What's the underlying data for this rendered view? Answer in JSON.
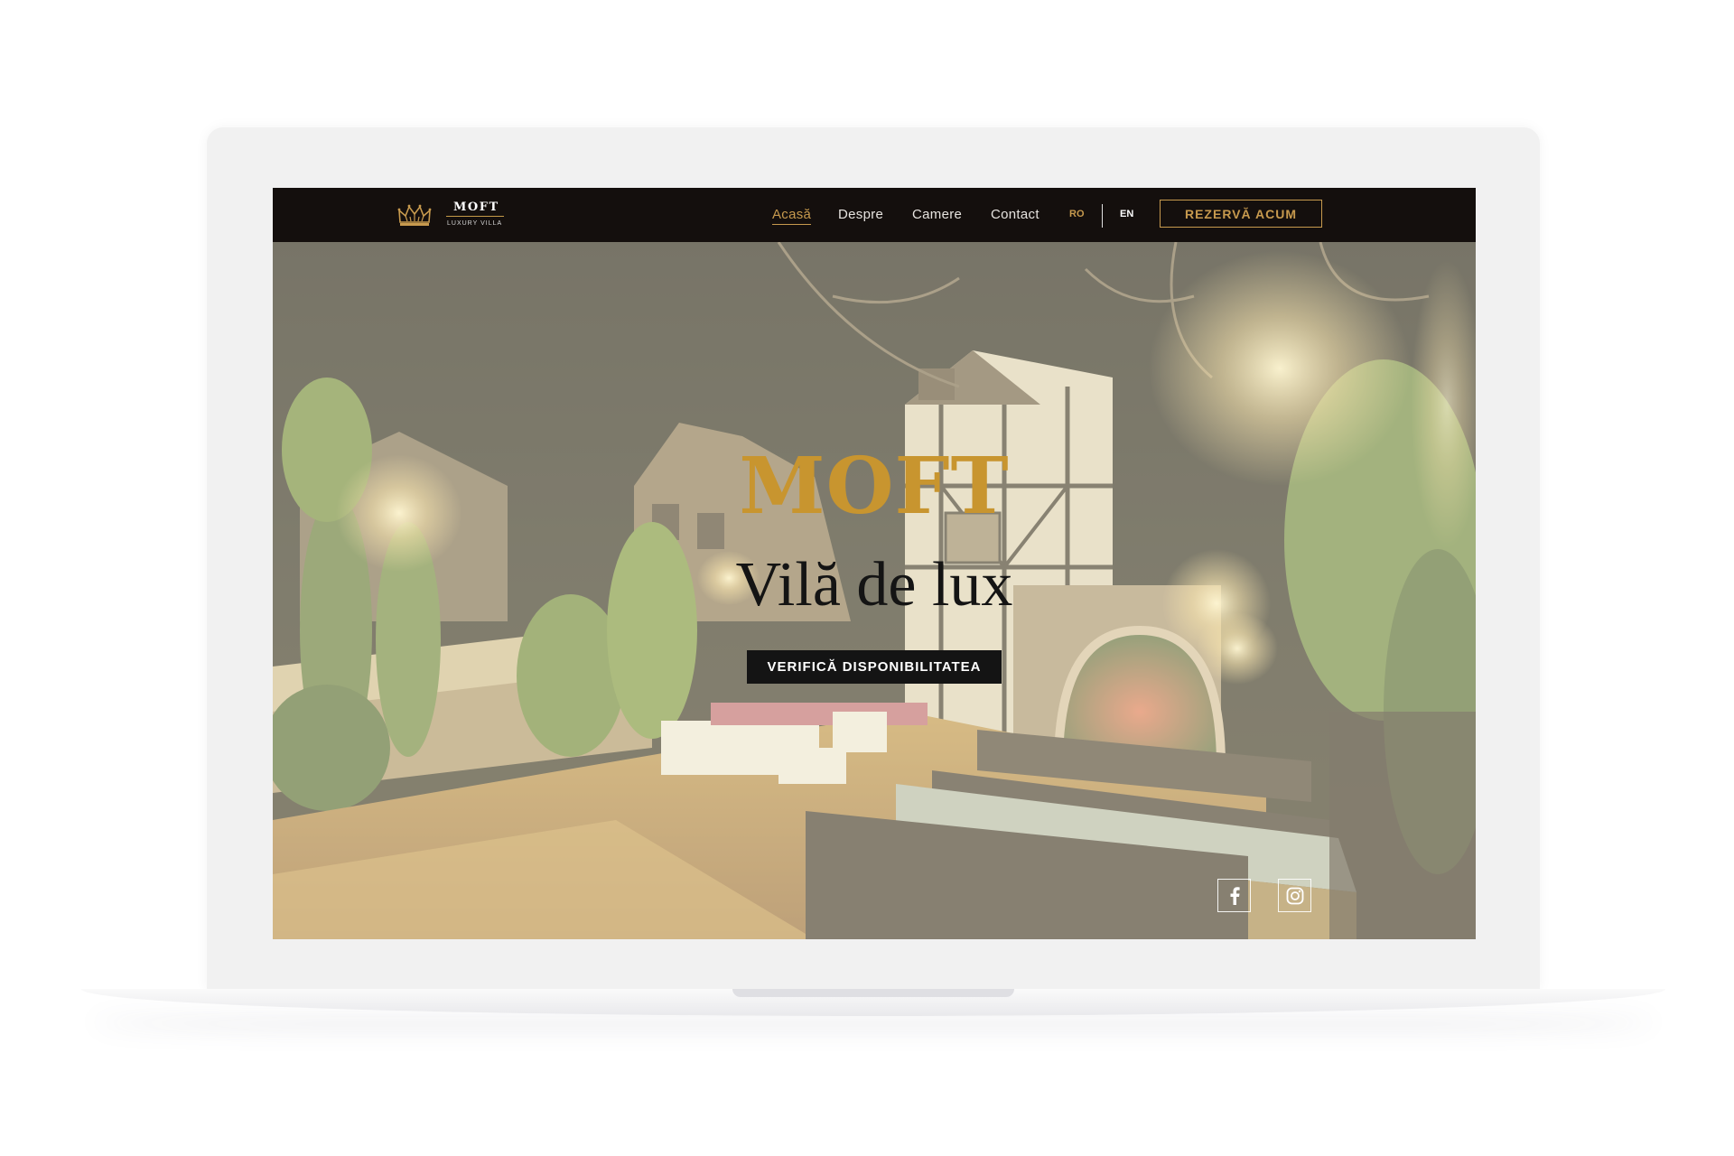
{
  "brand": {
    "name": "MOFT",
    "tagline": "LUXURY VILLA"
  },
  "nav": {
    "items": [
      {
        "label": "Acasă",
        "active": true
      },
      {
        "label": "Despre",
        "active": false
      },
      {
        "label": "Camere",
        "active": false
      },
      {
        "label": "Contact",
        "active": false
      }
    ],
    "languages": [
      {
        "code": "RO",
        "active": true
      },
      {
        "code": "EN",
        "active": false
      }
    ],
    "book_button": "REZERVĂ ACUM"
  },
  "hero": {
    "brand": "MOFT",
    "title": "Vilă de lux",
    "cta": "VERIFICĂ DISPONIBILITATEA"
  },
  "social": [
    {
      "icon": "facebook-icon"
    },
    {
      "icon": "instagram-icon"
    }
  ],
  "colors": {
    "accent_gold": "#c79a4e",
    "navbar_bg": "#140f0d",
    "cta_bg": "#141414"
  }
}
